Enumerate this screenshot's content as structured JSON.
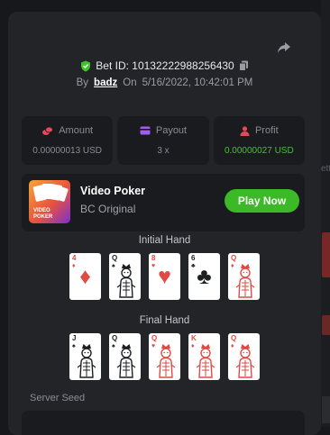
{
  "bet": {
    "id_text": "Bet ID: 10132222988256430"
  },
  "meta": {
    "by_label": "By",
    "user": "badz",
    "on_label": "On",
    "date": "5/16/2022, 10:42:01 PM"
  },
  "stats": [
    {
      "label": "Amount",
      "value": "0.00000013 USD",
      "icon": "coins-icon",
      "color": "#e6485a"
    },
    {
      "label": "Payout",
      "value": "3 x",
      "icon": "card-payout-icon",
      "color": "#a35cf0"
    },
    {
      "label": "Profit",
      "value": "0.00000027 USD",
      "icon": "user-profit-icon",
      "color": "#e6485a"
    }
  ],
  "game": {
    "name": "Video Poker",
    "subtitle": "BC Original",
    "play_label": "Play Now",
    "thumb_text": "VIDEO POKER"
  },
  "initial_hand": {
    "label": "Initial Hand",
    "cards": [
      {
        "rank": "4",
        "suit": "♦",
        "color": "red"
      },
      {
        "rank": "Q",
        "suit": "♠",
        "color": "black"
      },
      {
        "rank": "8",
        "suit": "♥",
        "color": "red"
      },
      {
        "rank": "6",
        "suit": "♣",
        "color": "black"
      },
      {
        "rank": "Q",
        "suit": "♦",
        "color": "red"
      }
    ]
  },
  "final_hand": {
    "label": "Final Hand",
    "cards": [
      {
        "rank": "J",
        "suit": "♠",
        "color": "black"
      },
      {
        "rank": "Q",
        "suit": "♠",
        "color": "black"
      },
      {
        "rank": "Q",
        "suit": "♥",
        "color": "red"
      },
      {
        "rank": "K",
        "suit": "♦",
        "color": "red"
      },
      {
        "rank": "Q",
        "suit": "♦",
        "color": "red"
      }
    ]
  },
  "server_seed": {
    "label": "Server Seed"
  },
  "background": {
    "peek_text": "ett"
  }
}
